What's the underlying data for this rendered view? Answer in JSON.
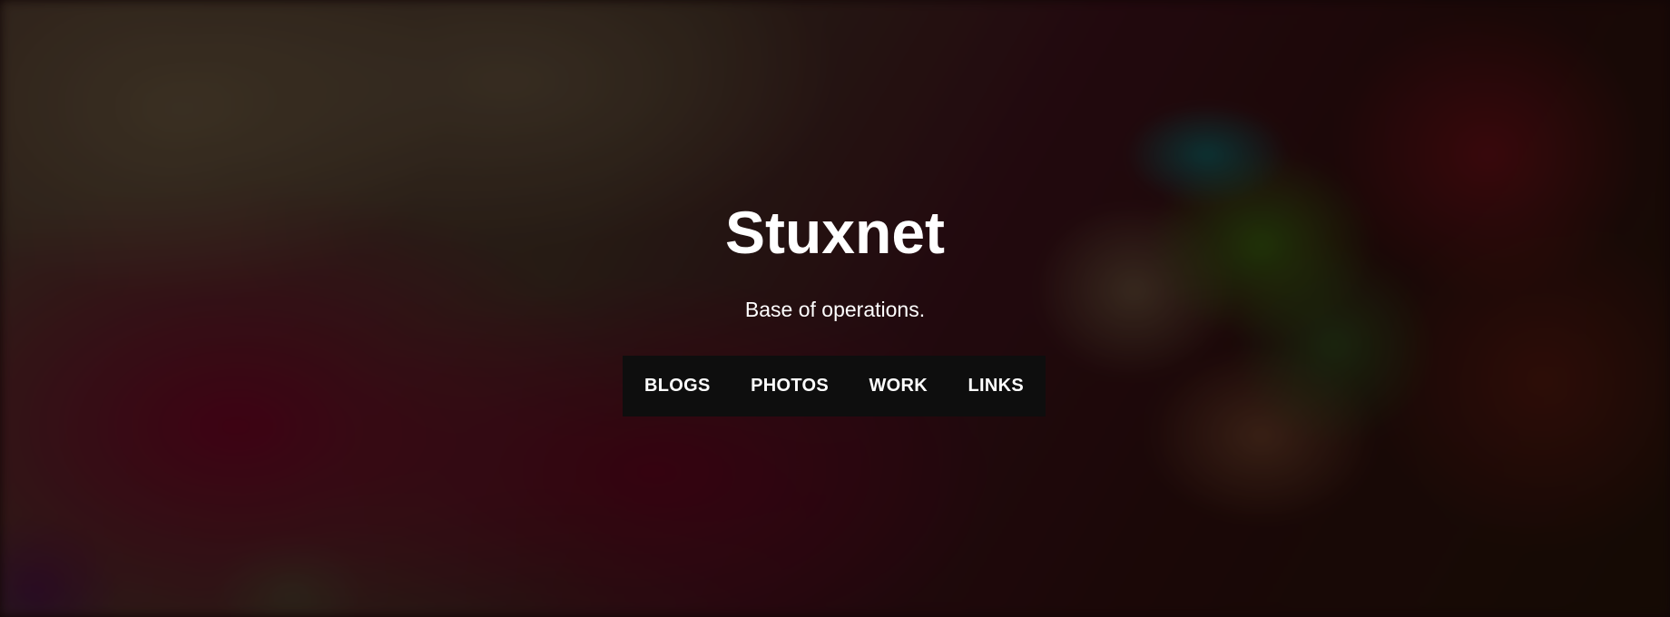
{
  "site": {
    "title": "Stuxnet",
    "tagline": "Base of operations."
  },
  "nav": {
    "items": [
      {
        "label": "BLOGS"
      },
      {
        "label": "PHOTOS"
      },
      {
        "label": "WORK"
      },
      {
        "label": "LINKS"
      }
    ]
  },
  "colors": {
    "text": "#ffffff",
    "nav_background": "#0e0e0e"
  }
}
